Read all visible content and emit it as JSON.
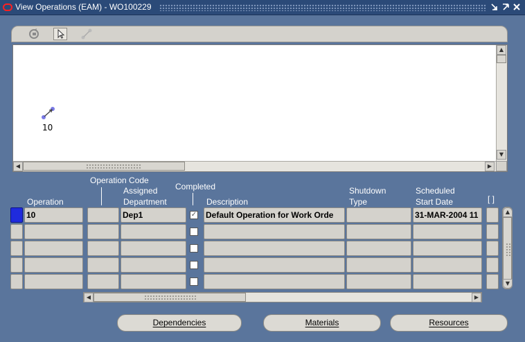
{
  "window": {
    "title": "View Operations (EAM) - WO100229",
    "controls": [
      "minimize-icon",
      "maximize-icon",
      "close-icon"
    ]
  },
  "toolbar": {
    "icons": [
      "refresh-icon",
      "select-pointer-icon",
      "link-dependency-icon"
    ]
  },
  "canvas": {
    "nodes": [
      {
        "label": "10",
        "icon": "operation-node-icon"
      }
    ]
  },
  "table": {
    "headers": {
      "operation": "Operation",
      "operation_code": "Operation Code",
      "assigned_department_line1": "Assigned",
      "assigned_department_line2": "Department",
      "completed": "Completed",
      "description": "Description",
      "shutdown_type_line1": "Shutdown",
      "shutdown_type_line2": "Type",
      "scheduled_start_line1": "Scheduled",
      "scheduled_start_line2": "Start Date",
      "extra": "[ ]"
    },
    "rows": [
      {
        "operation": "10",
        "operation_code": "",
        "department": "Dep1",
        "completed": true,
        "description": "Default Operation for Work Orde",
        "shutdown_type": "",
        "scheduled_start": "31-MAR-2004 11"
      },
      {
        "operation": "",
        "operation_code": "",
        "department": "",
        "completed": false,
        "description": "",
        "shutdown_type": "",
        "scheduled_start": ""
      },
      {
        "operation": "",
        "operation_code": "",
        "department": "",
        "completed": false,
        "description": "",
        "shutdown_type": "",
        "scheduled_start": ""
      },
      {
        "operation": "",
        "operation_code": "",
        "department": "",
        "completed": false,
        "description": "",
        "shutdown_type": "",
        "scheduled_start": ""
      },
      {
        "operation": "",
        "operation_code": "",
        "department": "",
        "completed": false,
        "description": "",
        "shutdown_type": "",
        "scheduled_start": ""
      }
    ]
  },
  "buttons": {
    "dependencies": "Dependencies",
    "materials": "Materials",
    "resources": "Resources"
  }
}
